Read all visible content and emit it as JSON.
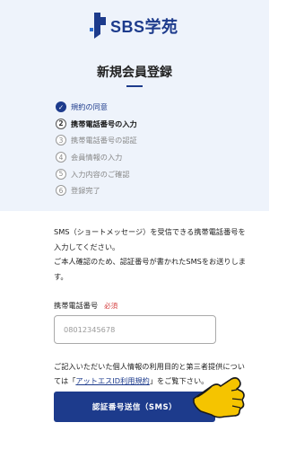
{
  "brand": {
    "name": "SBS学苑",
    "color": "#1d3b8c"
  },
  "page": {
    "title": "新規会員登録"
  },
  "steps": [
    {
      "num": "✓",
      "label": "規約の同意",
      "state": "done"
    },
    {
      "num": "2",
      "label": "携帯電話番号の入力",
      "state": "current"
    },
    {
      "num": "3",
      "label": "携帯電話番号の認証",
      "state": "todo"
    },
    {
      "num": "4",
      "label": "会員情報の入力",
      "state": "todo"
    },
    {
      "num": "5",
      "label": "入力内容のご確認",
      "state": "todo"
    },
    {
      "num": "6",
      "label": "登録完了",
      "state": "todo"
    }
  ],
  "description": {
    "line1": "SMS（ショートメッセージ）を受信できる携帯電話番号を入力してください。",
    "line2": "ご本人確認のため、認証番号が書かれたSMSをお送りします。"
  },
  "phone_field": {
    "label": "携帯電話番号",
    "required": "必須",
    "placeholder": "08012345678",
    "value": ""
  },
  "privacy": {
    "before": "ご記入いただいた個人情報の利用目的と第三者提供については「",
    "link": "アットエスID利用規約",
    "after": "」をご覧下さい。"
  },
  "submit": {
    "label": "認証番号送信（SMS）"
  },
  "pointer": {
    "icon": "pointing-hand-icon",
    "color": "#f5c400"
  }
}
